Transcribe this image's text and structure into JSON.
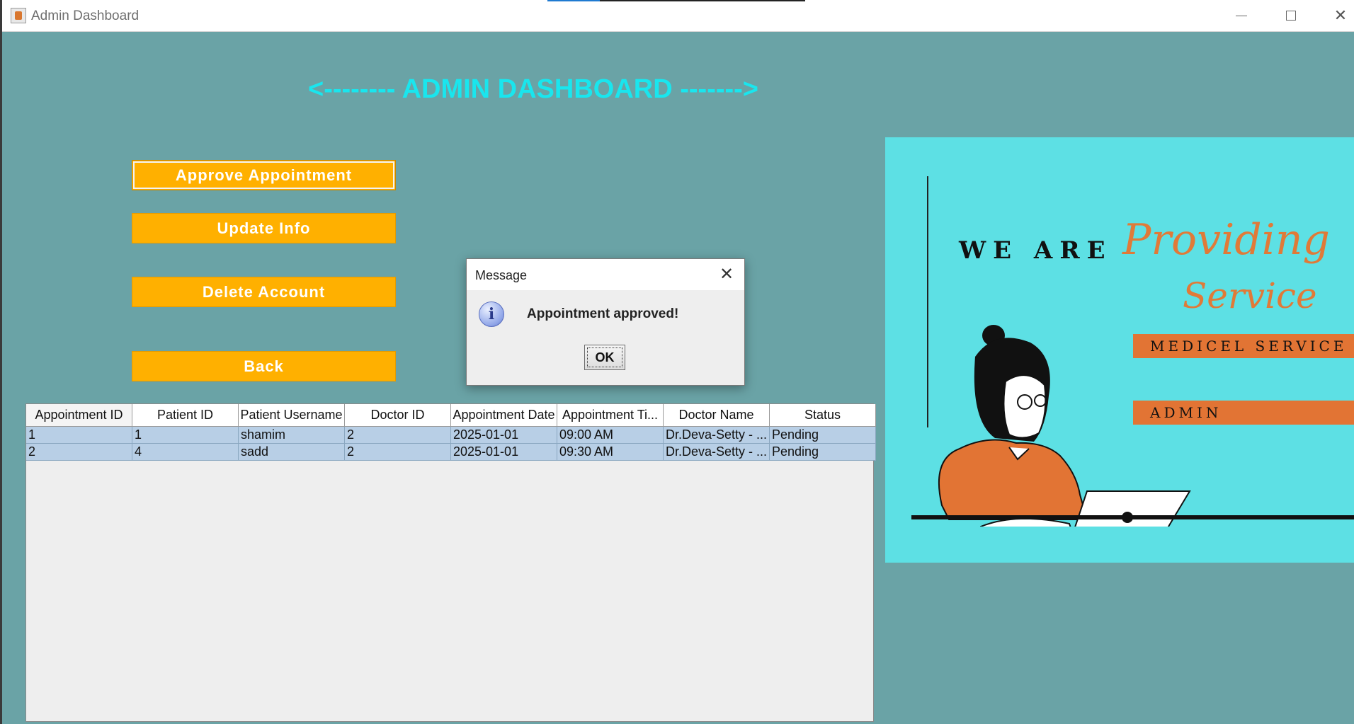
{
  "window": {
    "title": "Admin Dashboard",
    "close_glyph": "✕"
  },
  "dashboard": {
    "heading": "<-------- ADMIN DASHBOARD ------->",
    "buttons": {
      "approve": "Approve Appointment",
      "update": "Update Info",
      "delete": "Delete Account",
      "back": "Back"
    }
  },
  "table": {
    "columns": [
      "Appointment ID",
      "Patient ID",
      "Patient Username",
      "Doctor ID",
      "Appointment Date",
      "Appointment Ti...",
      "Doctor Name",
      "Status"
    ],
    "rows": [
      [
        "1",
        "1",
        "shamim",
        "2",
        "2025-01-01",
        "09:00 AM",
        "Dr.Deva-Setty - ...",
        "Pending"
      ],
      [
        "2",
        "4",
        "sadd",
        "2",
        "2025-01-01",
        "09:30 AM",
        "Dr.Deva-Setty - ...",
        "Pending"
      ]
    ]
  },
  "poster": {
    "line1": "WE ARE",
    "script1": "Providing",
    "script2": "Service",
    "badge1": "MEDICEL SERVICE",
    "badge2": "ADMIN"
  },
  "dialog": {
    "title": "Message",
    "message": "Appointment approved!",
    "ok_label": "OK",
    "close_glyph": "✕",
    "icon_glyph": "i"
  },
  "colors": {
    "background": "#6aa3a6",
    "heading": "#19e6ee",
    "button": "#ffb000",
    "poster_bg": "#5de0e4",
    "accent_orange": "#e27434",
    "row_selected": "#b8cfe6"
  }
}
